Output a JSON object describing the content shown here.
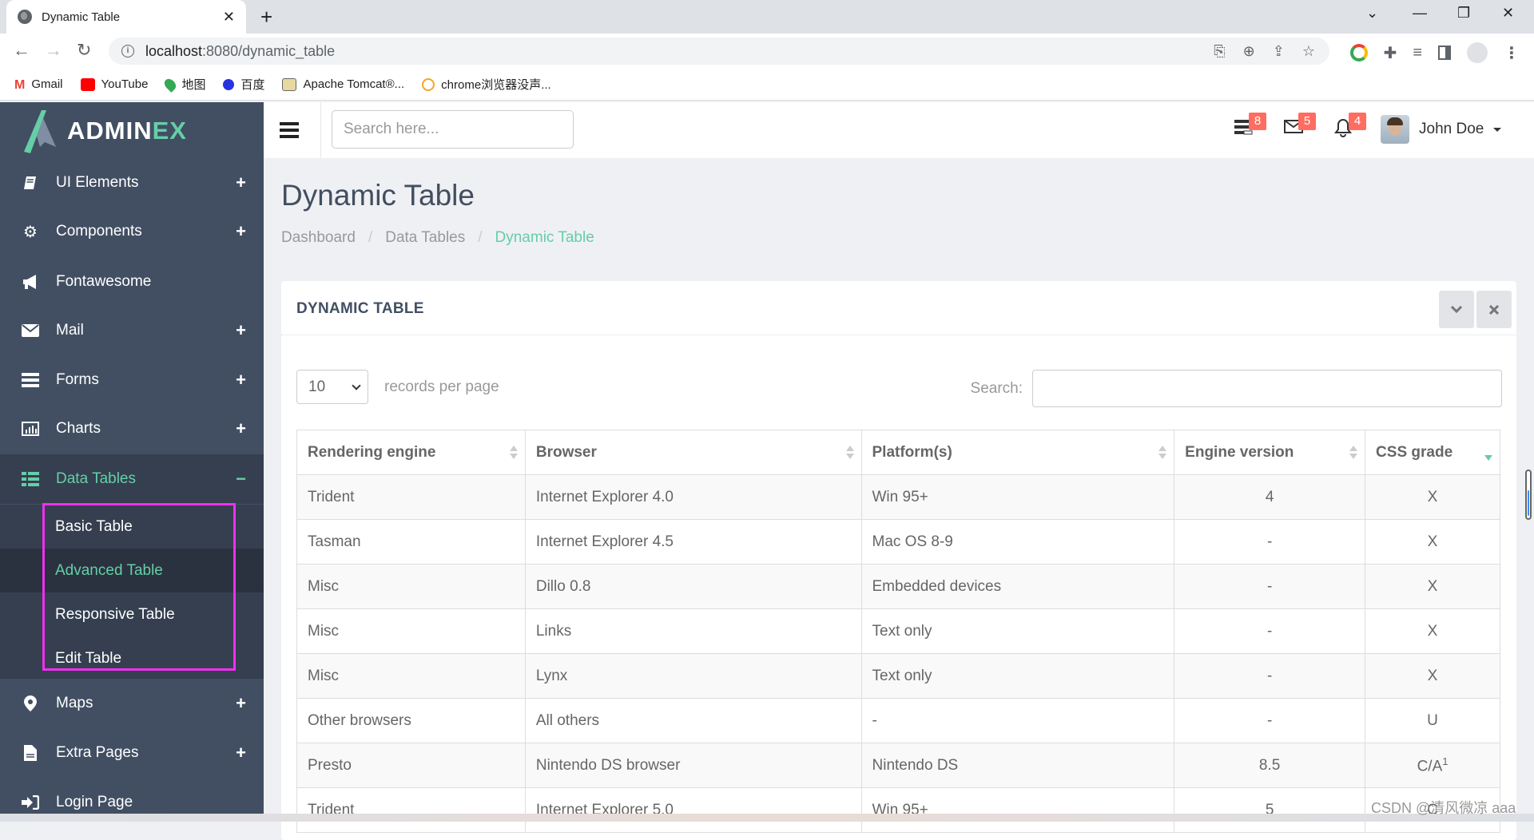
{
  "browser": {
    "tab_title": "Dynamic Table",
    "url_host": "localhost",
    "url_rest": ":8080/dynamic_table",
    "bookmarks": [
      {
        "label": "Gmail",
        "icon": "gmail-icon",
        "color": "#ea4335"
      },
      {
        "label": "YouTube",
        "icon": "youtube-icon",
        "color": "#ff0000"
      },
      {
        "label": "地图",
        "icon": "maps-pin-icon",
        "color": "#34a853"
      },
      {
        "label": "百度",
        "icon": "baidu-paw-icon",
        "color": "#2932e1"
      },
      {
        "label": "Apache Tomcat®...",
        "icon": "tomcat-icon",
        "color": "#d4a017"
      },
      {
        "label": "chrome浏览器没声...",
        "icon": "smiley-icon",
        "color": "#f5a623"
      }
    ]
  },
  "sidebar": {
    "logo_main": "ADMIN",
    "logo_accent": "EX",
    "items": [
      {
        "label": "UI Elements",
        "icon": "book-icon",
        "expand": "+"
      },
      {
        "label": "Components",
        "icon": "cogs-icon",
        "expand": "+"
      },
      {
        "label": "Fontawesome",
        "icon": "bullhorn-icon",
        "expand": ""
      },
      {
        "label": "Mail",
        "icon": "envelope-icon",
        "expand": "+"
      },
      {
        "label": "Forms",
        "icon": "tasks-icon",
        "expand": "+"
      },
      {
        "label": "Charts",
        "icon": "bar-chart-icon",
        "expand": "+"
      },
      {
        "label": "Data Tables",
        "icon": "table-icon",
        "expand": "−"
      },
      {
        "label": "Maps",
        "icon": "map-marker-icon",
        "expand": "+"
      },
      {
        "label": "Extra Pages",
        "icon": "file-icon",
        "expand": "+"
      },
      {
        "label": "Login Page",
        "icon": "sign-in-icon",
        "expand": ""
      }
    ],
    "submenu": [
      {
        "label": "Basic Table"
      },
      {
        "label": "Advanced Table"
      },
      {
        "label": "Responsive Table"
      },
      {
        "label": "Edit Table"
      }
    ]
  },
  "header": {
    "search_placeholder": "Search here...",
    "badges": {
      "tasks": "8",
      "mail": "5",
      "notifications": "4"
    },
    "user_name": "John Doe"
  },
  "page": {
    "title": "Dynamic Table",
    "breadcrumb": [
      "Dashboard",
      "Data Tables",
      "Dynamic Table"
    ]
  },
  "panel": {
    "title": "DYNAMIC TABLE",
    "length_value": "10",
    "length_label": "records per page",
    "search_label": "Search:",
    "search_value": ""
  },
  "table": {
    "columns": [
      "Rendering engine",
      "Browser",
      "Platform(s)",
      "Engine version",
      "CSS grade"
    ],
    "sorted_column": "CSS grade",
    "sort_direction": "desc",
    "rows": [
      [
        "Trident",
        "Internet Explorer 4.0",
        "Win 95+",
        "4",
        "X"
      ],
      [
        "Tasman",
        "Internet Explorer 4.5",
        "Mac OS 8-9",
        "-",
        "X"
      ],
      [
        "Misc",
        "Dillo 0.8",
        "Embedded devices",
        "-",
        "X"
      ],
      [
        "Misc",
        "Links",
        "Text only",
        "-",
        "X"
      ],
      [
        "Misc",
        "Lynx",
        "Text only",
        "-",
        "X"
      ],
      [
        "Other browsers",
        "All others",
        "-",
        "-",
        "U"
      ],
      [
        "Presto",
        "Nintendo DS browser",
        "Nintendo DS",
        "8.5",
        "C/A"
      ],
      [
        "Trident",
        "Internet Explorer 5.0",
        "Win 95+",
        "5",
        "C"
      ]
    ],
    "footnote_row": 6,
    "footnote_mark": "1"
  },
  "watermark": "CSDN @清风微凉 aaa",
  "colors": {
    "accent": "#65cea7",
    "sidebar_bg": "#424f63",
    "badge": "#ff6c60",
    "highlight_box": "#f02ff0"
  }
}
